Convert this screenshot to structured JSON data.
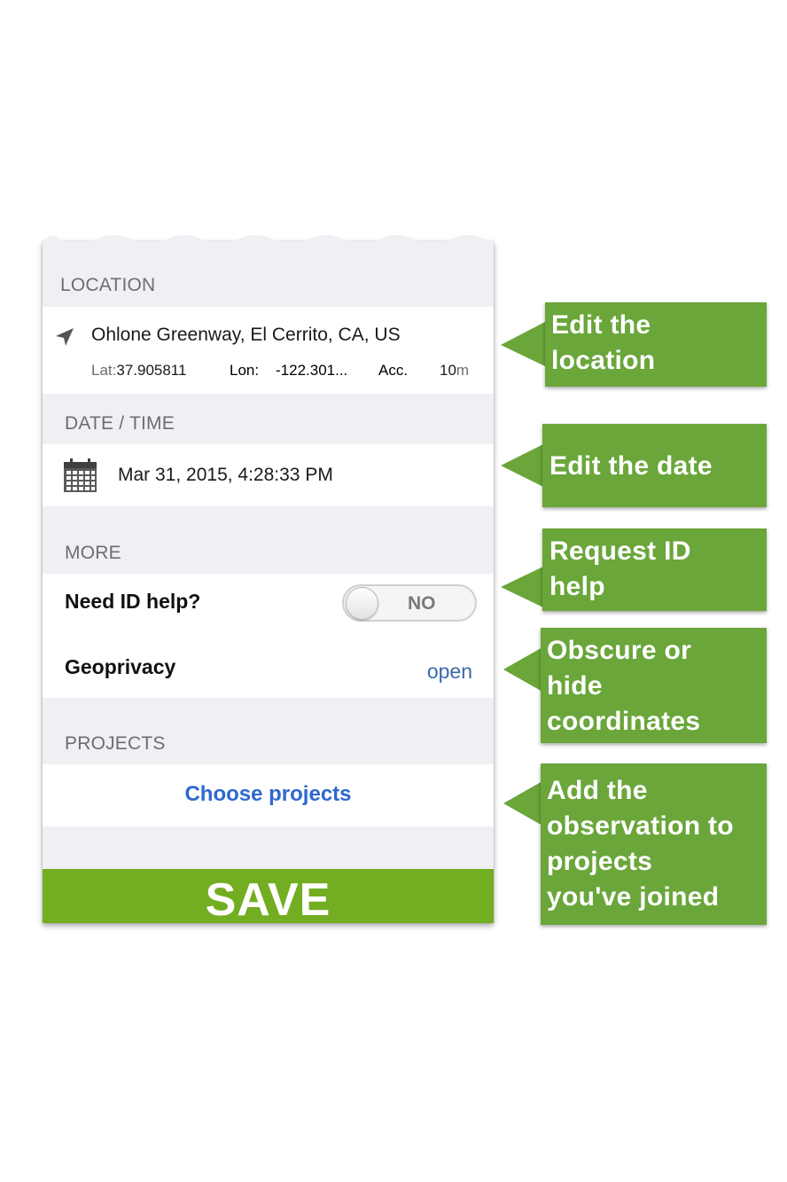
{
  "location": {
    "header": "LOCATION",
    "name": "Ohlone Greenway, El Cerrito, CA, US",
    "lat_label": "Lat:",
    "lat_value": "37.905811",
    "lon_label": "Lon:",
    "lon_value": "-122.301...",
    "acc_label": "Acc.",
    "acc_value": "10",
    "acc_unit": "m",
    "icon": "location-arrow-icon"
  },
  "datetime": {
    "header": "DATE / TIME",
    "value": "Mar 31, 2015, 4:28:33 PM",
    "icon": "calendar-icon"
  },
  "more": {
    "header": "MORE",
    "id_help_label": "Need ID help?",
    "id_help_toggle": "NO",
    "geoprivacy_label": "Geoprivacy",
    "geoprivacy_value": "open"
  },
  "projects": {
    "header": "PROJECTS",
    "choose_label": "Choose projects"
  },
  "save_label": "SAVE",
  "callouts": [
    {
      "line1": "Edit the",
      "line2": "location"
    },
    {
      "line1": "Edit the date"
    },
    {
      "line1": "Request ID",
      "line2": "help"
    },
    {
      "line1": "Obscure or",
      "line2": "hide",
      "line3": "coordinates"
    },
    {
      "line1": "Add the",
      "line2": "observation to",
      "line3": "projects",
      "line4": "you've joined"
    }
  ],
  "colors": {
    "callout_green": "#6aa63a",
    "save_green": "#73ad22",
    "link_blue": "#2e67d0",
    "section_bg": "#efeff4"
  }
}
